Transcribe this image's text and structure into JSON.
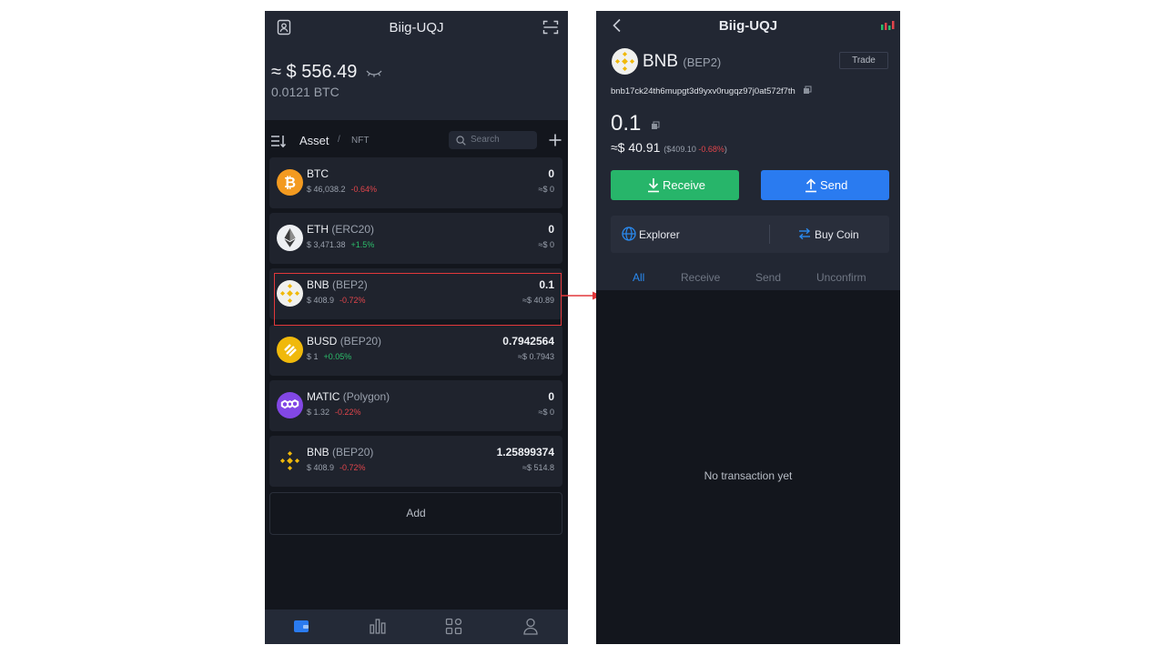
{
  "left": {
    "title": "Biig-UQJ",
    "balance": "≈ $ 556.49",
    "balance_btc": "0.0121 BTC",
    "tabs": {
      "asset": "Asset",
      "separator": "/",
      "nft": "NFT"
    },
    "search": {
      "placeholder": "Search"
    },
    "assets": [
      {
        "name": "BTC",
        "network": "",
        "price": "$ 46,038.2",
        "change": "-0.64%",
        "change_dir": "down",
        "amount": "0",
        "fiat": "≈$ 0"
      },
      {
        "name": "ETH",
        "network": "(ERC20)",
        "price": "$ 3,471.38",
        "change": "+1.5%",
        "change_dir": "up",
        "amount": "0",
        "fiat": "≈$ 0"
      },
      {
        "name": "BNB",
        "network": "(BEP2)",
        "price": "$ 408.9",
        "change": "-0.72%",
        "change_dir": "down",
        "amount": "0.1",
        "fiat": "≈$ 40.89"
      },
      {
        "name": "BUSD",
        "network": "(BEP20)",
        "price": "$ 1",
        "change": "+0.05%",
        "change_dir": "up",
        "amount": "0.7942564",
        "fiat": "≈$ 0.7943"
      },
      {
        "name": "MATIC",
        "network": "(Polygon)",
        "price": "$ 1.32",
        "change": "-0.22%",
        "change_dir": "down",
        "amount": "0",
        "fiat": "≈$ 0"
      },
      {
        "name": "BNB",
        "network": "(BEP20)",
        "price": "$ 408.9",
        "change": "-0.72%",
        "change_dir": "down",
        "amount": "1.25899374",
        "fiat": "≈$ 514.8"
      }
    ],
    "add_label": "Add",
    "nav_icons": [
      "wallet-icon",
      "market-chart-icon",
      "apps-grid-icon",
      "profile-icon"
    ]
  },
  "right": {
    "title": "Biig-UQJ",
    "coin": {
      "name": "BNB",
      "network": "(BEP2)"
    },
    "trade_label": "Trade",
    "address": "bnb17ck24th6mupgt3d9yxv0rugqz97j0at572f7th",
    "amount": "0.1",
    "fiat": "≈$ 40.91",
    "fiat_paren_open": "(",
    "fiat_price": "$409.10",
    "fiat_change": "-0.68%",
    "fiat_paren_close": ")",
    "receive_label": "Receive",
    "send_label": "Send",
    "explorer_label": "Explorer",
    "buy_coin_label": "Buy Coin",
    "tx_tabs": [
      "All",
      "Receive",
      "Send",
      "Unconfirm"
    ],
    "empty_message": "No transaction yet"
  },
  "colors": {
    "background": "#13161d",
    "card": "#1f232d",
    "header": "#222733",
    "receive_green": "#27b56a",
    "send_blue": "#2a7bf0",
    "negative_red": "#e0454b",
    "positive_green": "#2cbe6b",
    "highlight_red": "#e2383b",
    "active_tab_blue": "#2a8af0"
  }
}
